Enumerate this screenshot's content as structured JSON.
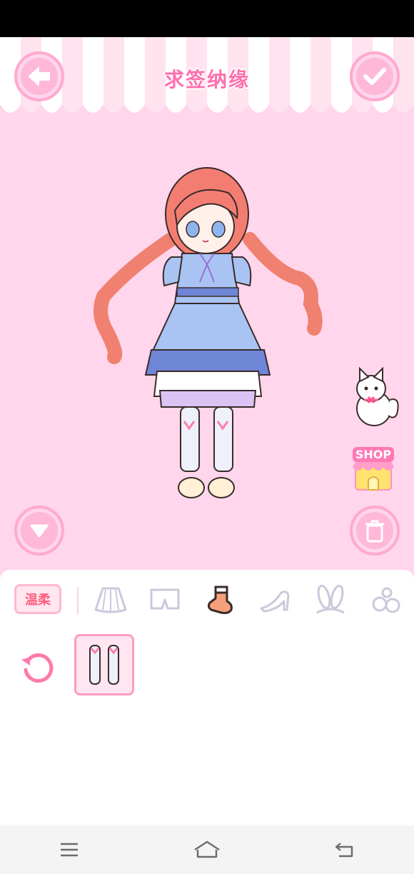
{
  "app": {
    "title": "求签纳缘"
  },
  "shop": {
    "label": "SHOP"
  },
  "panel": {
    "style_tag": "温柔",
    "categories": [
      {
        "name": "skirt",
        "icon": "skirt-icon",
        "selected": false
      },
      {
        "name": "shorts",
        "icon": "shorts-icon",
        "selected": false
      },
      {
        "name": "socks",
        "icon": "sock-icon",
        "selected": true
      },
      {
        "name": "shoes",
        "icon": "high-heel-icon",
        "selected": false
      },
      {
        "name": "headwear",
        "icon": "bunny-ears-icon",
        "selected": false
      },
      {
        "name": "accessories",
        "icon": "flower-accessory-icon",
        "selected": false
      }
    ],
    "items": [
      {
        "name": "stockings",
        "icon": "stockings-icon",
        "selected": true
      }
    ]
  },
  "colors": {
    "background": "#ffd6ec",
    "accent": "#ff6fae",
    "button_border": "#ffa9d0",
    "tag_text": "#ff5d7e"
  }
}
